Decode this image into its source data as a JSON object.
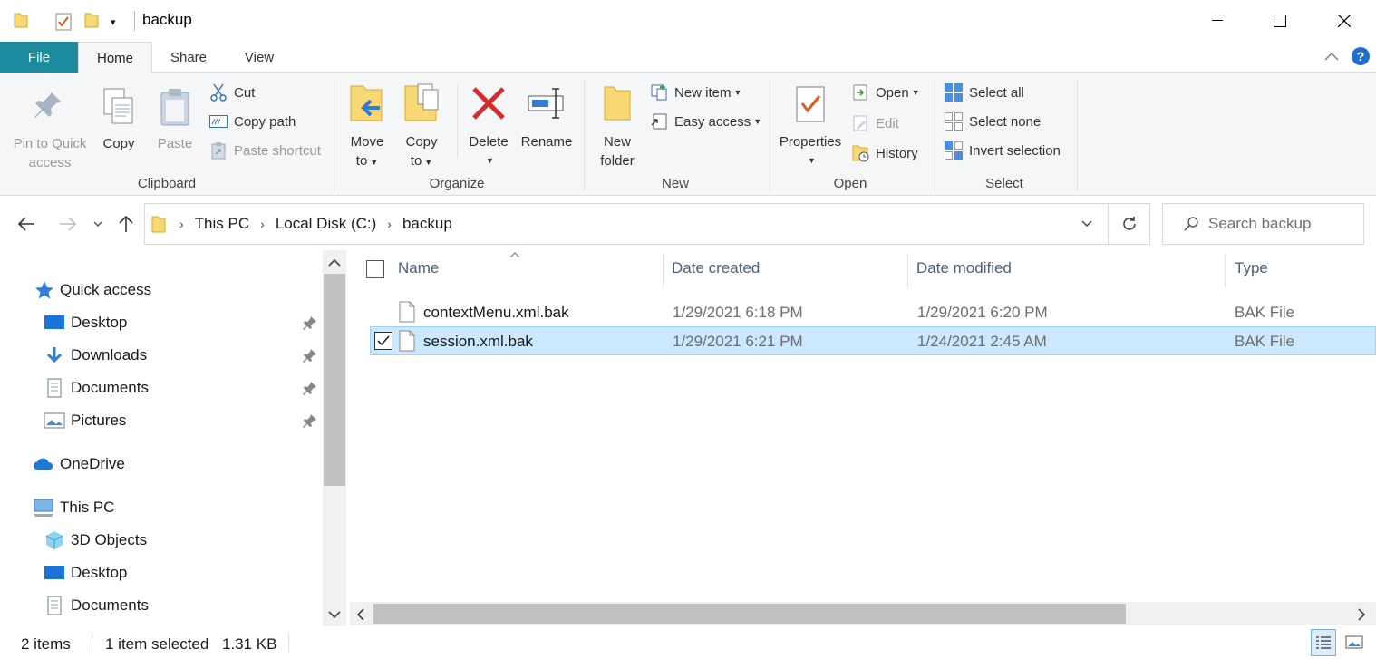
{
  "window": {
    "title": "backup"
  },
  "ribbon": {
    "tabs": [
      "File",
      "Home",
      "Share",
      "View"
    ],
    "clipboard": {
      "pin_label_1": "Pin to Quick",
      "pin_label_2": "access",
      "copy": "Copy",
      "paste": "Paste",
      "cut": "Cut",
      "copy_path": "Copy path",
      "paste_shortcut": "Paste shortcut",
      "group": "Clipboard"
    },
    "organize": {
      "move_1": "Move",
      "move_2": "to",
      "copy_1": "Copy",
      "copy_2": "to",
      "delete": "Delete",
      "rename": "Rename",
      "group": "Organize"
    },
    "new": {
      "folder_1": "New",
      "folder_2": "folder",
      "new_item": "New item",
      "easy_access": "Easy access",
      "group": "New"
    },
    "open": {
      "properties": "Properties",
      "open": "Open",
      "edit": "Edit",
      "history": "History",
      "group": "Open"
    },
    "select": {
      "select_all": "Select all",
      "select_none": "Select none",
      "invert": "Invert selection",
      "group": "Select"
    }
  },
  "address": {
    "crumbs": [
      "This PC",
      "Local Disk (C:)",
      "backup"
    ],
    "search_placeholder": "Search backup"
  },
  "nav": {
    "quick_access": "Quick access",
    "quick_items": [
      "Desktop",
      "Downloads",
      "Documents",
      "Pictures"
    ],
    "onedrive": "OneDrive",
    "this_pc": "This PC",
    "pc_items": [
      "3D Objects",
      "Desktop",
      "Documents"
    ]
  },
  "list": {
    "columns": [
      "Name",
      "Date created",
      "Date modified",
      "Type"
    ],
    "rows": [
      {
        "name": "contextMenu.xml.bak",
        "created": "1/29/2021 6:18 PM",
        "modified": "1/29/2021 6:20 PM",
        "type": "BAK File",
        "selected": false
      },
      {
        "name": "session.xml.bak",
        "created": "1/29/2021 6:21 PM",
        "modified": "1/24/2021 2:45 AM",
        "type": "BAK File",
        "selected": true
      }
    ]
  },
  "status": {
    "count": "2 items",
    "selected": "1 item selected",
    "size": "1.31 KB"
  },
  "colors": {
    "file_tab": "#1a8a9c",
    "selection": "#cce8ff",
    "folder": "#f8d775",
    "accent": "#0078d7"
  }
}
